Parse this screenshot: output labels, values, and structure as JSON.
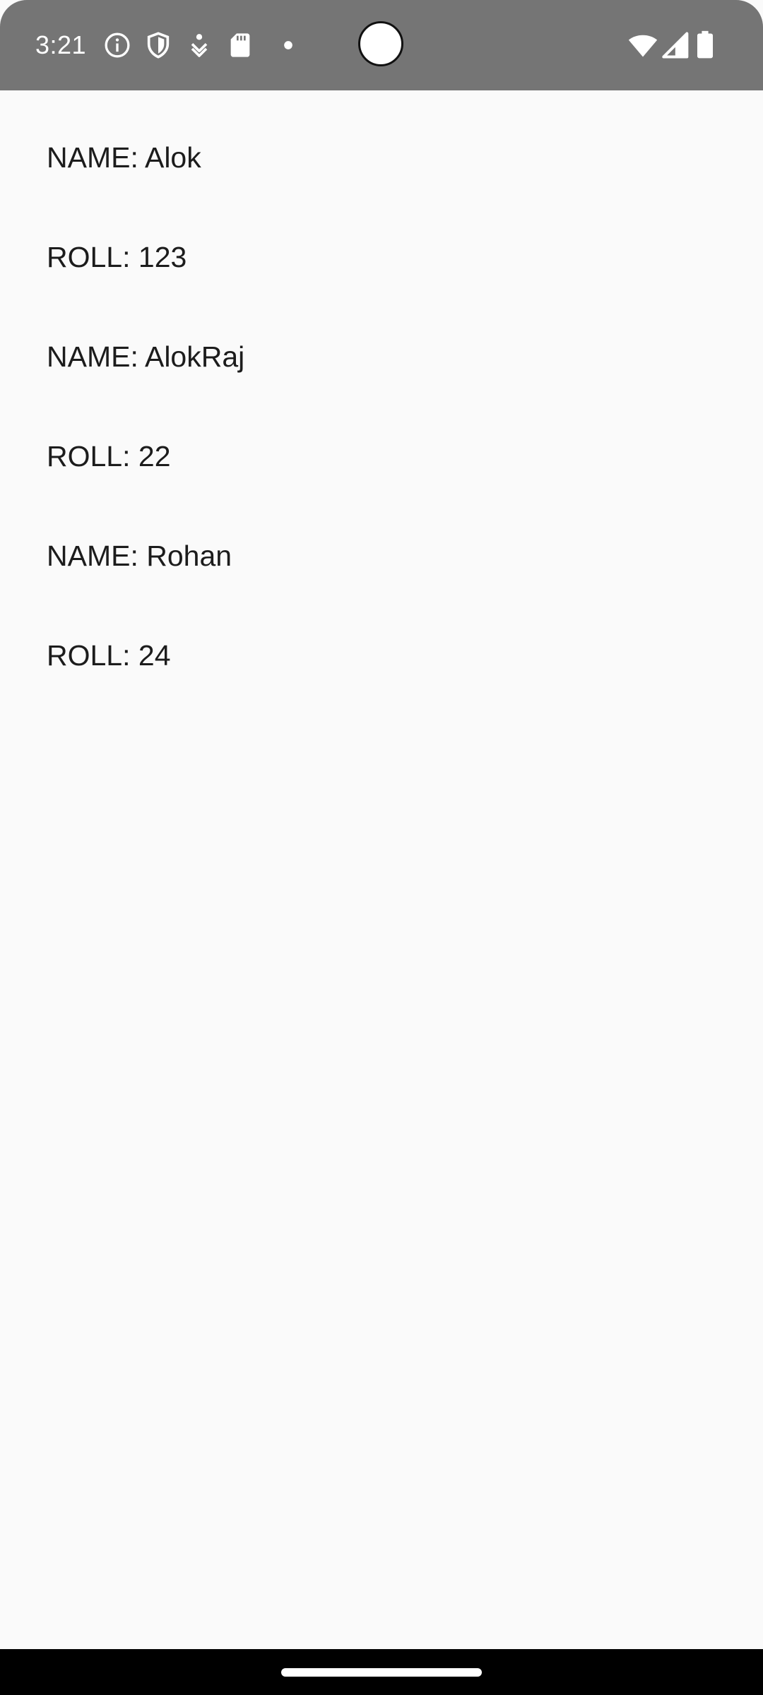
{
  "status_bar": {
    "time": "3:21",
    "left_icons": [
      "info-icon",
      "shield-icon",
      "download-icon",
      "sd-card-icon",
      "dot-icon"
    ],
    "right_icons": [
      "wifi-icon",
      "cellular-signal-icon",
      "battery-icon"
    ]
  },
  "records": [
    {
      "name_line": "NAME: Alok",
      "roll_line": "ROLL: 123"
    },
    {
      "name_line": "NAME: AlokRaj",
      "roll_line": "ROLL: 22"
    },
    {
      "name_line": "NAME: Rohan",
      "roll_line": "ROLL: 24"
    }
  ]
}
